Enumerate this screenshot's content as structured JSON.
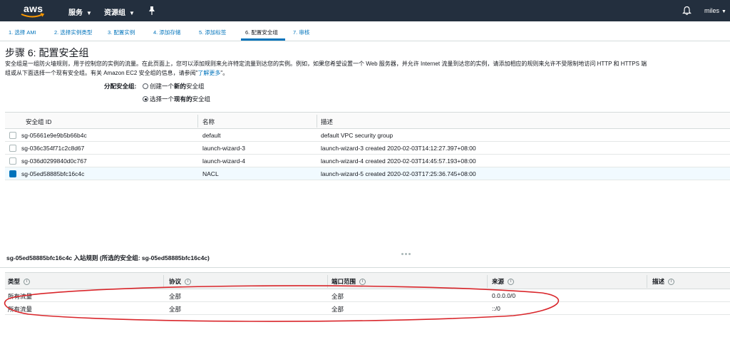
{
  "header": {
    "logo_text": "aws",
    "services_label": "服务",
    "resource_groups_label": "资源组",
    "user_label": "miles",
    "pin_icon": "pin-icon",
    "bell_icon": "bell-icon",
    "bg_color": "#232f3e"
  },
  "steps": [
    {
      "label": "1. 选择 AMI"
    },
    {
      "label": "2. 选择实例类型"
    },
    {
      "label": "3. 配置实例"
    },
    {
      "label": "4. 添加存储"
    },
    {
      "label": "5. 添加标签"
    },
    {
      "label": "6. 配置安全组",
      "active": true
    },
    {
      "label": "7. 审核"
    }
  ],
  "page": {
    "title": "步骤 6: 配置安全组",
    "intro_line1": "安全组是一组防火墙规则，用于控制您的实例的流量。在此页面上，您可以添加规则来允许特定流量到达您的实例。例如，如果您希望设置一个 Web 服务器，并允许 Internet 流量到达您的实例，请添加相应的规则来允许不受限制地访问 HTTP 和 HTTPS 端",
    "intro_line2_prefix": "组或从下面选择一个现有安全组。有关 Amazon EC2 安全组的信息，请参阅\"",
    "intro_link": "了解更多",
    "intro_line2_suffix": "\"。",
    "assign_label": "分配安全组:",
    "option_create_pre": "创建一个",
    "option_create_bold": "新的",
    "option_create_post": "安全组",
    "option_select_pre": "选择一个",
    "option_select_bold": "现有的",
    "option_select_post": "安全组"
  },
  "sg_table": {
    "headers": [
      "安全组 ID",
      "名称",
      "描述"
    ],
    "rows": [
      {
        "id": "sg-05661e9e9b5b66b4c",
        "name": "default",
        "desc": "default VPC security group",
        "selected": false
      },
      {
        "id": "sg-036c354f71c2c8d67",
        "name": "launch-wizard-3",
        "desc": "launch-wizard-3 created 2020-02-03T14:12:27.397+08:00",
        "selected": false
      },
      {
        "id": "sg-036d0299840d0c767",
        "name": "launch-wizard-4",
        "desc": "launch-wizard-4 created 2020-02-03T14:45:57.193+08:00",
        "selected": false
      },
      {
        "id": "sg-05ed58885bfc16c4c",
        "name": "NACL",
        "desc": "launch-wizard-5 created 2020-02-03T17:25:36.745+08:00",
        "selected": true
      }
    ]
  },
  "detail": {
    "title": "sg-05ed58885bfc16c4c 入站规则 (所选的安全组: sg-05ed58885bfc16c4c)",
    "headers": [
      "类型",
      "协议",
      "端口范围",
      "来源",
      "描述"
    ],
    "info_glyph": "i",
    "rows": [
      {
        "type": "所有流量",
        "protocol": "全部",
        "port": "全部",
        "source": "0.0.0.0/0",
        "desc": ""
      },
      {
        "type": "所有流量",
        "protocol": "全部",
        "port": "全部",
        "source": "::/0",
        "desc": ""
      }
    ]
  },
  "colors": {
    "link": "#0073bb",
    "selected_row": "#f1faff",
    "annotation": "#d9262b"
  }
}
